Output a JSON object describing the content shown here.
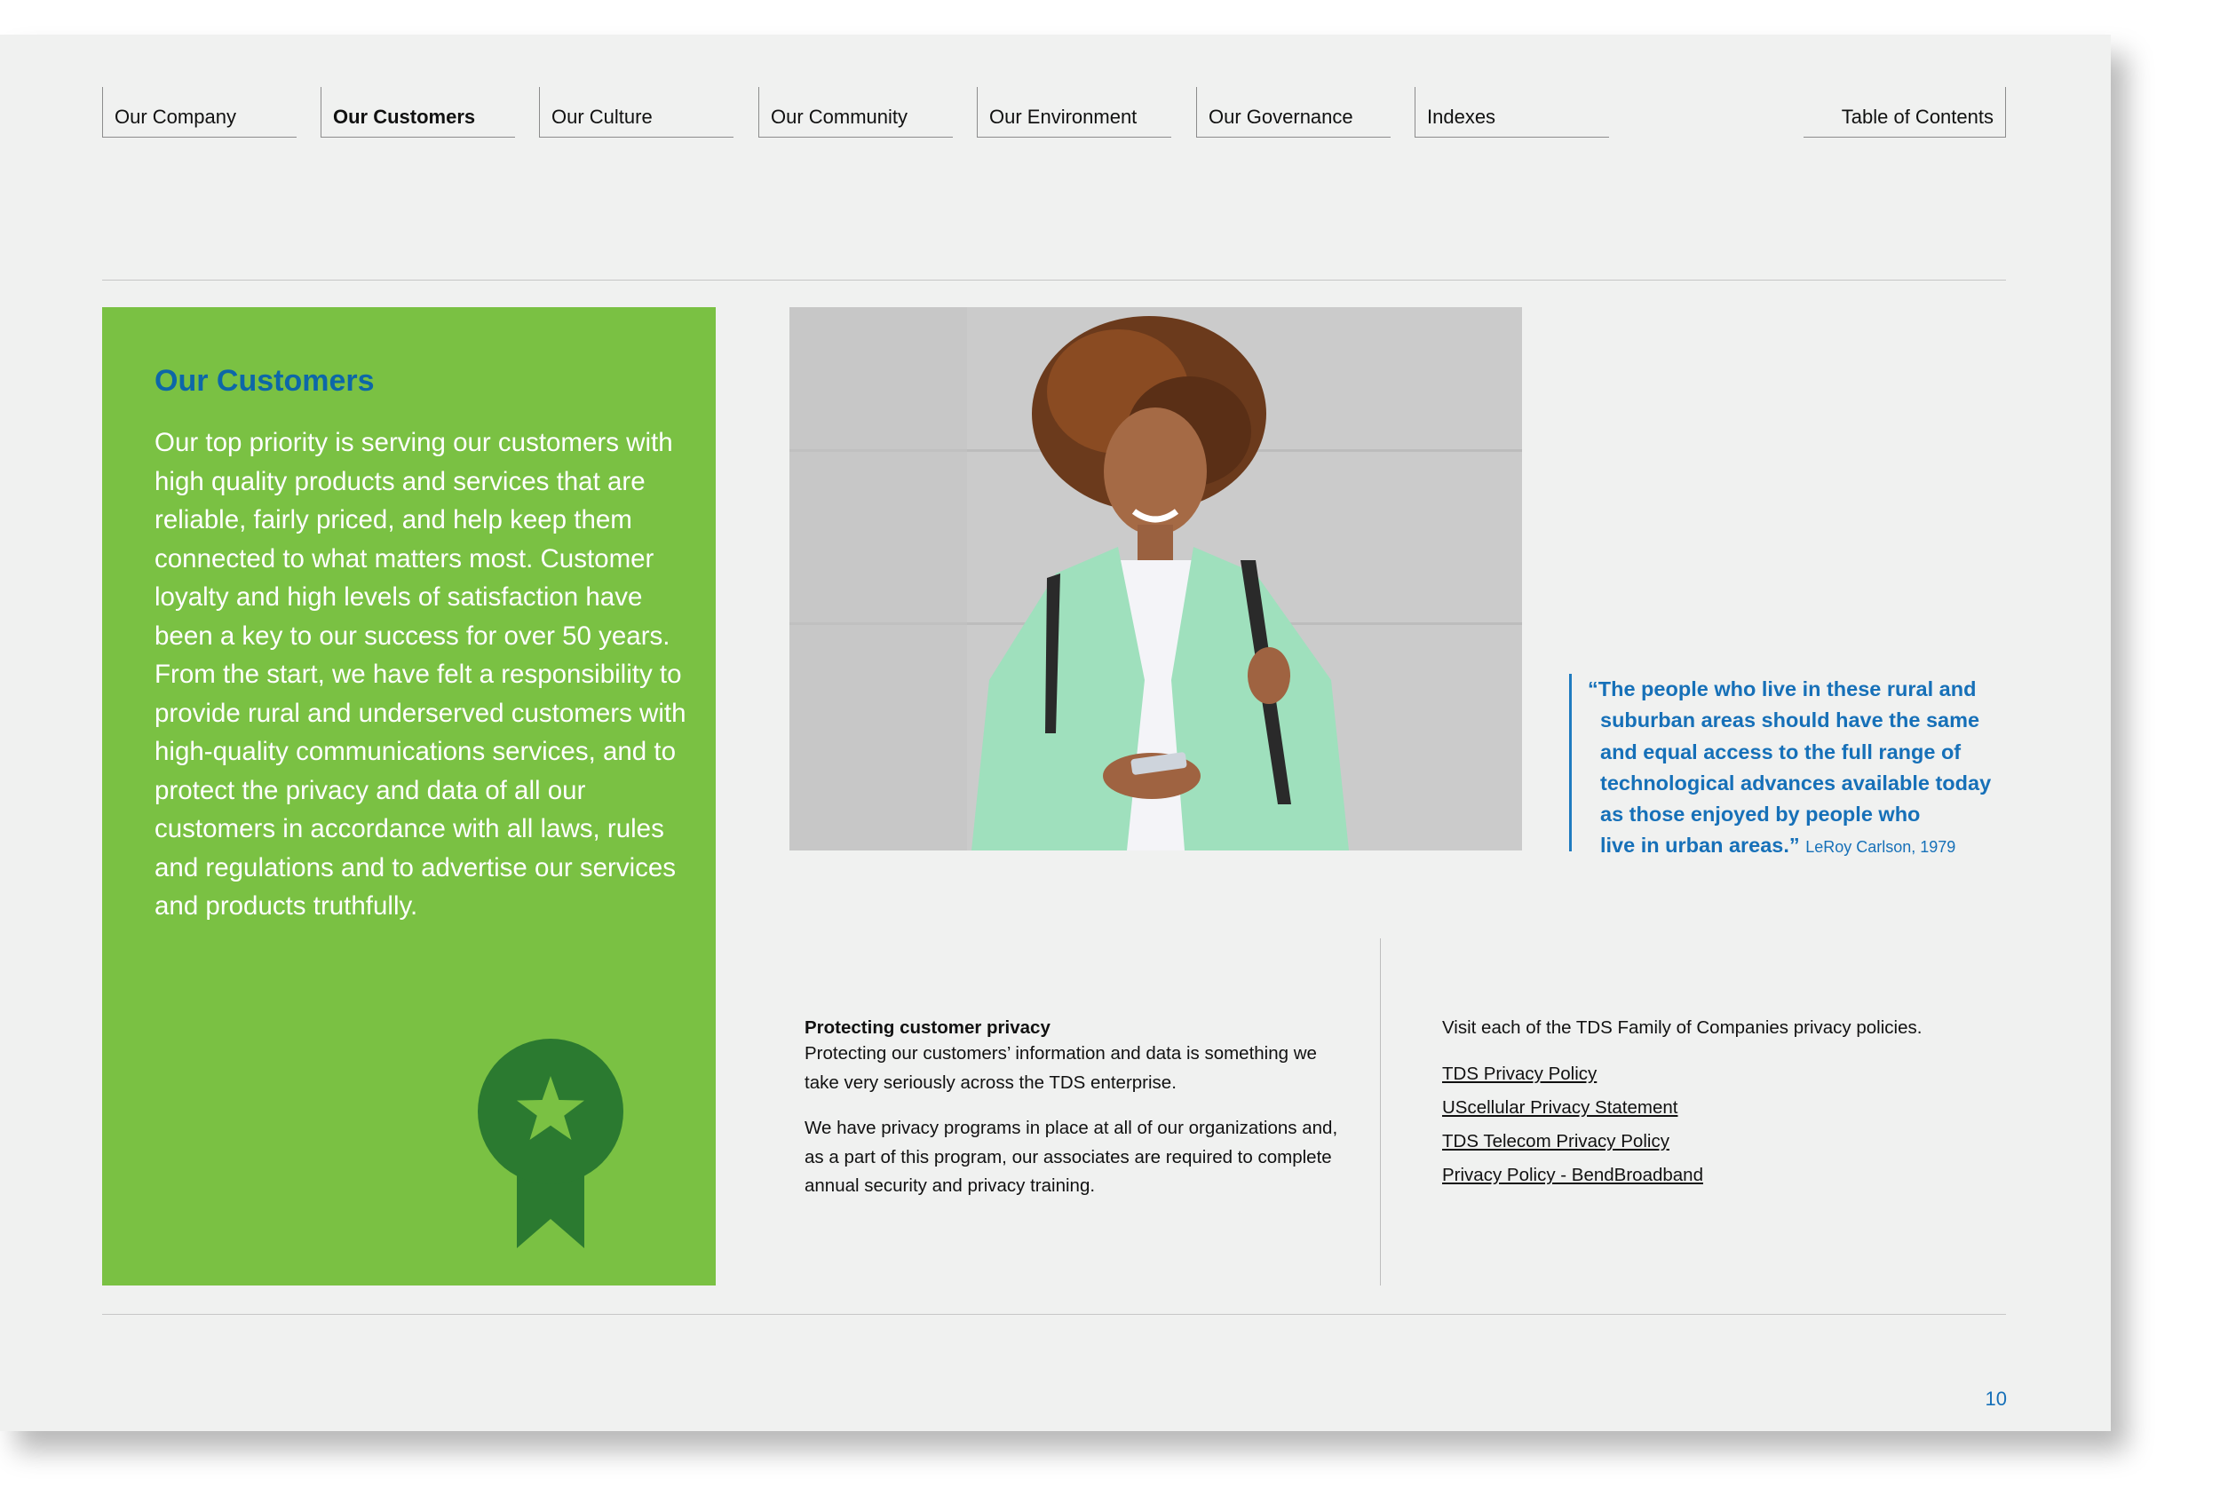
{
  "nav": {
    "tabs": [
      {
        "label": "Our Company"
      },
      {
        "label": "Our Customers"
      },
      {
        "label": "Our Culture"
      },
      {
        "label": "Our Community"
      },
      {
        "label": "Our Environment"
      },
      {
        "label": "Our Governance"
      },
      {
        "label": "Indexes"
      }
    ],
    "active": "Our Customers",
    "toc_label": "Table of Contents"
  },
  "intro": {
    "title": "Our Customers",
    "body": "Our top priority is serving our customers with high quality products and services that are reliable, fairly priced, and help keep them connected to what matters most. Customer loyalty and high levels of satisfaction have been a key to our success for over 50 years. From the start, we have felt a responsibility to provide rural and underserved customers with high-quality communications services, and to protect the privacy and data of all our customers in accordance with all laws, rules and regulations and to advertise our services and products truthfully."
  },
  "quote": {
    "lines": [
      "“The people who live in these rural and",
      "suburban areas should have the same",
      "and equal access to the full range of",
      "technological advances available today",
      "as those enjoyed by people who",
      "live in urban areas.”"
    ],
    "attribution": "LeRoy Carlson, 1979"
  },
  "privacy": {
    "heading": "Protecting customer privacy",
    "paragraphs": [
      "Protecting our customers’ information and data is something we take very seriously across the TDS enterprise.",
      "We have privacy programs in place at all of our organizations and, as a part of this program, our associates are required to complete annual security and privacy training."
    ]
  },
  "policies": {
    "intro": "Visit each of the TDS Family of Companies privacy policies.",
    "links": [
      "TDS Privacy Policy",
      "UScellular Privacy Statement",
      "TDS Telecom Privacy Policy",
      "Privacy Policy - BendBroadband"
    ]
  },
  "page_number": "10",
  "colors": {
    "green_panel": "#7ac143",
    "ribbon": "#2b7a30",
    "accent_blue": "#1670b8",
    "page_bg": "#f0f1f0"
  },
  "icons": {
    "award": "award-ribbon-icon"
  }
}
